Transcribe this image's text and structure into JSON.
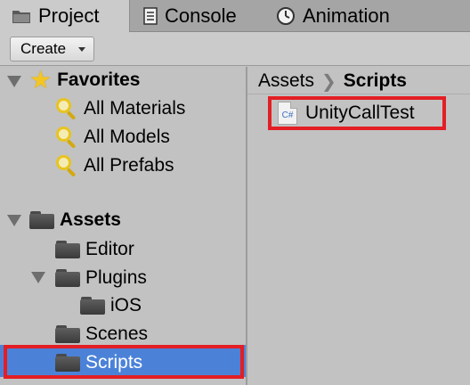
{
  "tabs": {
    "project": "Project",
    "console": "Console",
    "animation": "Animation"
  },
  "toolbar": {
    "create_label": "Create"
  },
  "tree": {
    "favorites": {
      "label": "Favorites",
      "items": [
        "All Materials",
        "All Models",
        "All Prefabs"
      ]
    },
    "assets": {
      "label": "Assets",
      "editor": "Editor",
      "plugins": "Plugins",
      "ios": "iOS",
      "scenes": "Scenes",
      "scripts": "Scripts"
    }
  },
  "breadcrumb": {
    "root": "Assets",
    "current": "Scripts"
  },
  "files": [
    {
      "name": "UnityCallTest",
      "badge": "C#"
    }
  ],
  "colors": {
    "selection": "#4b82d8",
    "highlight": "#e31e24"
  }
}
